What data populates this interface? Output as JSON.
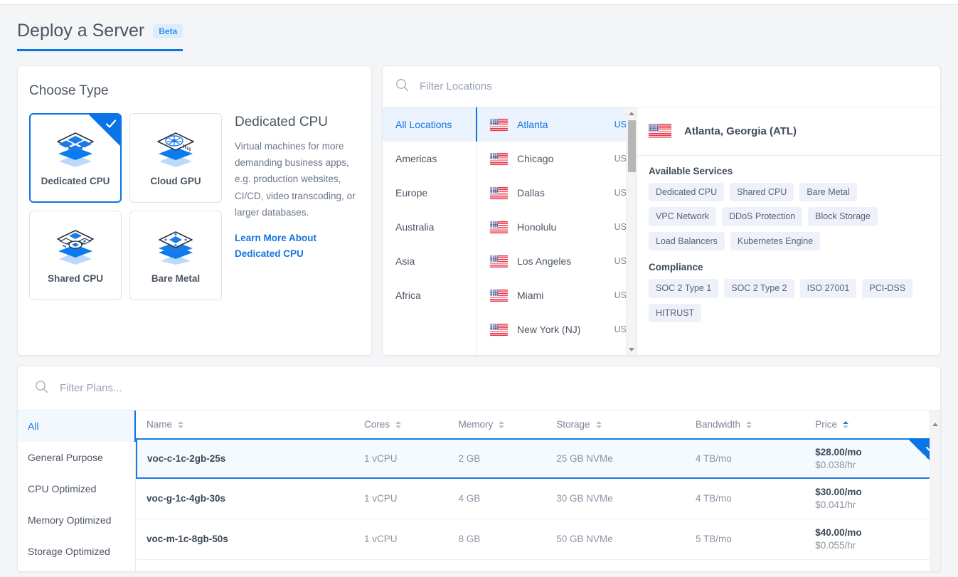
{
  "header": {
    "title": "Deploy a Server",
    "badge": "Beta"
  },
  "choose_type": {
    "heading": "Choose Type",
    "options": [
      {
        "label": "Dedicated CPU",
        "icon": "dedicated-cpu-icon",
        "selected": true
      },
      {
        "label": "Cloud GPU",
        "icon": "cloud-gpu-icon",
        "selected": false
      },
      {
        "label": "Shared CPU",
        "icon": "shared-cpu-icon",
        "selected": false
      },
      {
        "label": "Bare Metal",
        "icon": "bare-metal-icon",
        "selected": false
      }
    ],
    "detail": {
      "title": "Dedicated CPU",
      "description": "Virtual machines for more demanding business apps, e.g. production websites, CI/CD, video transcoding, or larger databases.",
      "link": "Learn More About Dedicated CPU"
    }
  },
  "locations": {
    "search_placeholder": "Filter Locations",
    "search_value": "",
    "regions": [
      {
        "label": "All Locations",
        "active": true
      },
      {
        "label": "Americas",
        "active": false
      },
      {
        "label": "Europe",
        "active": false
      },
      {
        "label": "Australia",
        "active": false
      },
      {
        "label": "Asia",
        "active": false
      },
      {
        "label": "Africa",
        "active": false
      }
    ],
    "cities": [
      {
        "name": "Atlanta",
        "code": "US",
        "active": true
      },
      {
        "name": "Chicago",
        "code": "US",
        "active": false
      },
      {
        "name": "Dallas",
        "code": "US",
        "active": false
      },
      {
        "name": "Honolulu",
        "code": "US",
        "active": false
      },
      {
        "name": "Los Angeles",
        "code": "US",
        "active": false
      },
      {
        "name": "Miami",
        "code": "US",
        "active": false
      },
      {
        "name": "New York (NJ)",
        "code": "US",
        "active": false
      }
    ],
    "detail": {
      "title": "Atlanta, Georgia (ATL)",
      "services_heading": "Available Services",
      "services": [
        "Dedicated CPU",
        "Shared CPU",
        "Bare Metal",
        "VPC Network",
        "DDoS Protection",
        "Block Storage",
        "Load Balancers",
        "Kubernetes Engine"
      ],
      "compliance_heading": "Compliance",
      "compliance": [
        "SOC 2 Type 1",
        "SOC 2 Type 2",
        "ISO 27001",
        "PCI-DSS",
        "HITRUST"
      ]
    }
  },
  "plans": {
    "search_placeholder": "Filter Plans...",
    "search_value": "",
    "categories": [
      {
        "label": "All",
        "active": true
      },
      {
        "label": "General Purpose",
        "active": false
      },
      {
        "label": "CPU Optimized",
        "active": false
      },
      {
        "label": "Memory Optimized",
        "active": false
      },
      {
        "label": "Storage Optimized",
        "active": false
      }
    ],
    "columns": [
      {
        "label": "Name",
        "sort": "none"
      },
      {
        "label": "Cores",
        "sort": "none"
      },
      {
        "label": "Memory",
        "sort": "none"
      },
      {
        "label": "Storage",
        "sort": "none"
      },
      {
        "label": "Bandwidth",
        "sort": "none"
      },
      {
        "label": "Price",
        "sort": "asc"
      }
    ],
    "rows": [
      {
        "name": "voc-c-1c-2gb-25s",
        "cores": "1 vCPU",
        "memory": "2 GB",
        "storage": "25 GB NVMe",
        "bandwidth": "4 TB/mo",
        "price_month": "$28.00/mo",
        "price_hour": "$0.038/hr",
        "selected": true
      },
      {
        "name": "voc-g-1c-4gb-30s",
        "cores": "1 vCPU",
        "memory": "4 GB",
        "storage": "30 GB NVMe",
        "bandwidth": "4 TB/mo",
        "price_month": "$30.00/mo",
        "price_hour": "$0.041/hr",
        "selected": false
      },
      {
        "name": "voc-m-1c-8gb-50s",
        "cores": "1 vCPU",
        "memory": "8 GB",
        "storage": "50 GB NVMe",
        "bandwidth": "5 TB/mo",
        "price_month": "$40.00/mo",
        "price_hour": "$0.055/hr",
        "selected": false
      }
    ]
  },
  "colors": {
    "accent": "#0a74e6",
    "link": "#1775e0",
    "page_bg": "#f4f5f7",
    "text": "#4b5663",
    "muted": "#8b93a2",
    "chip_bg": "#eef0fa",
    "selected_row_bg": "#f5faff"
  }
}
